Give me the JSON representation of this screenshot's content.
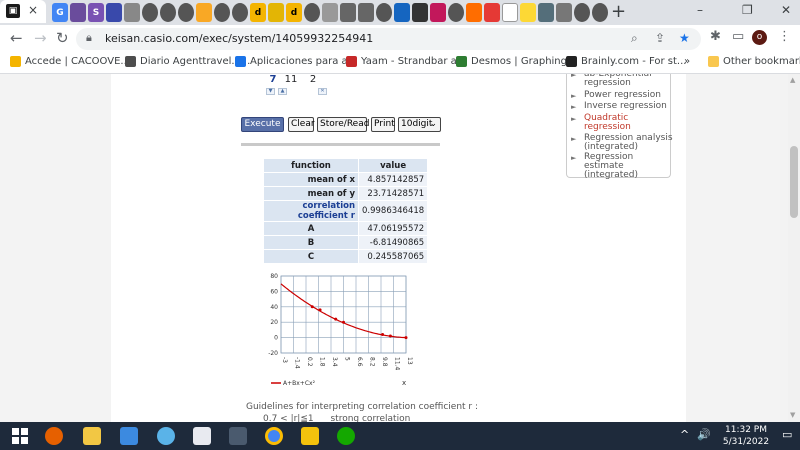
{
  "browser": {
    "active_tab_close": "×",
    "new_tab": "+",
    "window": {
      "minimize": "–",
      "maximize": "❐",
      "close": "✕"
    },
    "url": "keisan.casio.com/exec/system/14059932254941",
    "profile_initial": "o",
    "bookmarks": [
      {
        "label": "Accede | CACOOVE...",
        "color": "#f4b400"
      },
      {
        "label": "Diario Agenttravel.e...",
        "color": "#4d4d4d"
      },
      {
        "label": "Aplicaciones para a...",
        "color": "#1a73e8"
      },
      {
        "label": "Yaam - Strandbar a...",
        "color": "#c62828"
      },
      {
        "label": "Desmos | Graphing...",
        "color": "#2e7d32"
      },
      {
        "label": "Brainly.com - For st...",
        "color": "#222222"
      }
    ],
    "bookmarks_overflow": "»",
    "other_bookmarks": "Other bookmarks"
  },
  "page": {
    "entry_values": [
      "7",
      "11",
      "2"
    ],
    "buttons": {
      "execute": "Execute",
      "clear": "Clear",
      "store_read": "Store/Read",
      "print": "Print",
      "digits": "10digit"
    },
    "results": {
      "headers": [
        "function",
        "value"
      ],
      "rows": [
        {
          "label": "mean of x",
          "value": "4.857142857"
        },
        {
          "label": "mean of y",
          "value": "23.71428571"
        },
        {
          "label": "correlation coefficient r",
          "value": "0.9986346418"
        },
        {
          "label": "A",
          "value": "47.06195572"
        },
        {
          "label": "B",
          "value": "-6.81490865"
        },
        {
          "label": "C",
          "value": "0.245587065"
        }
      ]
    },
    "guidelines": "Guidelines for interpreting correlation coefficient r :",
    "guideline_row": {
      "range": "0.7 < |r|≦1",
      "meaning": "strong correlation"
    },
    "side_panel": [
      {
        "label": "ab-Exponential regression",
        "highlight": false
      },
      {
        "label": "Power regression",
        "highlight": false
      },
      {
        "label": "Inverse regression",
        "highlight": false
      },
      {
        "label": "Quadratic regression",
        "highlight": true
      },
      {
        "label": "Regression analysis (integrated)",
        "highlight": false
      },
      {
        "label": "Regression estimate (integrated)",
        "highlight": false
      }
    ]
  },
  "chart_data": {
    "type": "line",
    "title": "",
    "xlabel": "x",
    "ylabel": "",
    "xlim": [
      -3,
      13
    ],
    "ylim": [
      -20,
      80
    ],
    "x_ticks": [
      "-3",
      "-1.4",
      "0.2",
      "1.8",
      "3.4",
      "5",
      "6.6",
      "8.2",
      "9.8",
      "11.4",
      "13"
    ],
    "y_ticks": [
      "80",
      "60",
      "40",
      "20",
      "0",
      "-20"
    ],
    "grid": true,
    "legend_position": "bottom-left",
    "series": [
      {
        "name": "A+Bx+Cx²",
        "coefficients": {
          "A": 47.06195572,
          "B": -6.81490865,
          "C": 0.245587065
        },
        "color": "#cc0000"
      }
    ],
    "points": [
      {
        "x": 1,
        "y": 40
      },
      {
        "x": 2,
        "y": 36
      },
      {
        "x": 4,
        "y": 24
      },
      {
        "x": 5,
        "y": 20
      },
      {
        "x": 10,
        "y": 4
      },
      {
        "x": 11,
        "y": 2
      },
      {
        "x": 13,
        "y": 0
      }
    ]
  },
  "taskbar": {
    "time": "11:32 PM",
    "date": "5/31/2022",
    "tray_volume": "🔊",
    "tray_chevron": "^"
  }
}
